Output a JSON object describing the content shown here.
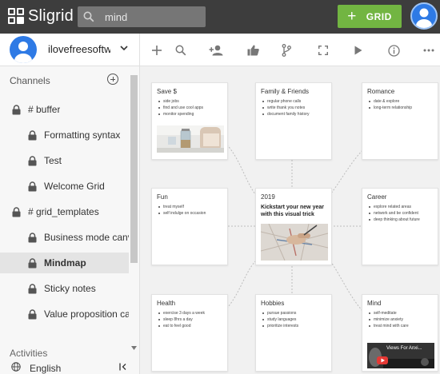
{
  "app": {
    "name": "Sligrid"
  },
  "search": {
    "value": "mind"
  },
  "header": {
    "grid_button": "GRID"
  },
  "user": {
    "name": "ilovefreesoftwa"
  },
  "sidebar": {
    "channels_heading": "Channels",
    "channels": [
      {
        "label": "# buffer",
        "level": 0
      },
      {
        "label": "Formatting syntax",
        "level": 1
      },
      {
        "label": "Test",
        "level": 1
      },
      {
        "label": "Welcome Grid",
        "level": 1
      },
      {
        "label": "# grid_templates",
        "level": 0
      },
      {
        "label": "Business mode canvas",
        "level": 1
      },
      {
        "label": "Mindmap",
        "level": 1,
        "active": true
      },
      {
        "label": "Sticky notes",
        "level": 1
      },
      {
        "label": "Value proposition canvas",
        "level": 1
      }
    ],
    "activities_heading": "Activities",
    "language": "English"
  },
  "toolbar": {
    "tools": [
      "add-icon",
      "search-icon",
      "add-user-icon",
      "like-icon",
      "branch-icon",
      "fullscreen-icon",
      "play-icon",
      "info-icon",
      "more-icon"
    ]
  },
  "mindmap": {
    "cards": {
      "save": {
        "title": "Save $",
        "items": [
          "side jobs",
          "find and use cool apps",
          "monitor spending"
        ]
      },
      "family": {
        "title": "Family & Friends",
        "items": [
          "regular phone calls",
          "write thank you notes",
          "document family history"
        ]
      },
      "romance": {
        "title": "Romance",
        "items": [
          "date & explore",
          "long-term relationship"
        ]
      },
      "fun": {
        "title": "Fun",
        "items": [
          "treat myself",
          "self indulge on occasion"
        ]
      },
      "center": {
        "title": "2019",
        "subtitle": "Kickstart your new year with this visual trick"
      },
      "career": {
        "title": "Career",
        "items": [
          "explore related areas",
          "network and be confident",
          "deep thinking about future"
        ]
      },
      "health": {
        "title": "Health",
        "items": [
          "exercise 3 days a week",
          "sleep 8hrs a day",
          "eat to feel good"
        ]
      },
      "hobbies": {
        "title": "Hobbies",
        "items": [
          "pursue passions",
          "study languages",
          "prioritize interests"
        ]
      },
      "mind": {
        "title": "Mind",
        "items": [
          "self-meditate",
          "minimize anxiety",
          "treat mind with care"
        ],
        "video_title": "Views For Anxi..."
      }
    }
  },
  "colors": {
    "topbar": "#3d3d3d",
    "accent_green": "#72b542",
    "avatar_blue": "#2e7ae5",
    "canvas": "#f1f1f1"
  }
}
